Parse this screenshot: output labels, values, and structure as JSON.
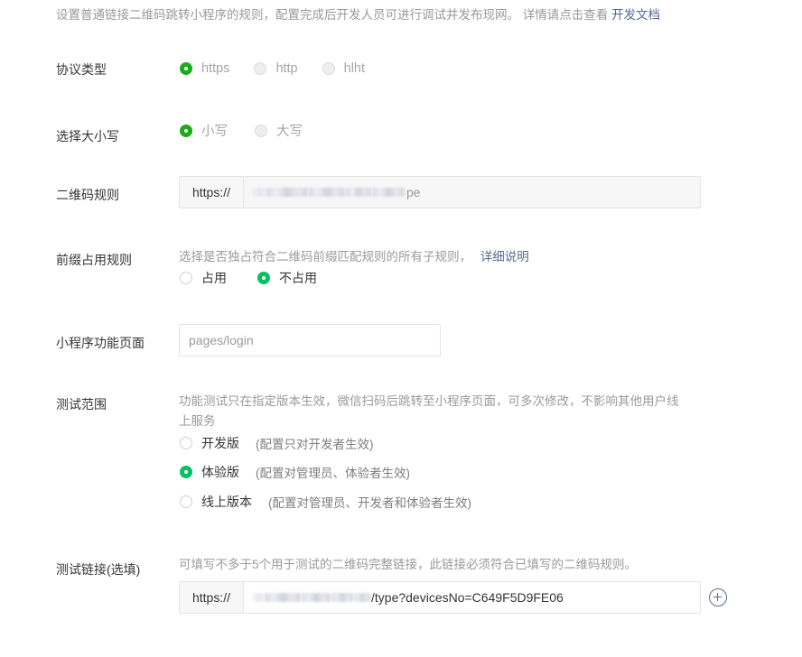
{
  "intro": {
    "text": "设置普通链接二维码跳转小程序的规则，配置完成后开发人员可进行调试并发布现网。 详情请点击查看",
    "link": "开发文档"
  },
  "protocol": {
    "label": "协议类型",
    "options": [
      "https",
      "http",
      "hlht"
    ],
    "selected": "https"
  },
  "case": {
    "label": "选择大小写",
    "options": [
      "小写",
      "大写"
    ],
    "selected": "小写"
  },
  "qr_rule": {
    "label": "二维码规则",
    "prefix": "https://",
    "value_suffix": "pe"
  },
  "prefix_rule": {
    "label": "前缀占用规则",
    "hint": "选择是否独占符合二维码前缀匹配规则的所有子规则，",
    "link": "详细说明",
    "options": [
      "占用",
      "不占用"
    ],
    "selected": "不占用"
  },
  "page": {
    "label": "小程序功能页面",
    "value": "pages/login"
  },
  "scope": {
    "label": "测试范围",
    "hint_line1": "功能测试只在指定版本生效，微信扫码后跳转至小程序页面，可多次修改，不影响其他用户线",
    "hint_line2": "上服务",
    "options": [
      {
        "label": "开发版",
        "note": "(配置只对开发者生效)"
      },
      {
        "label": "体验版",
        "note": "(配置对管理员、体验者生效)"
      },
      {
        "label": "线上版本",
        "note": "(配置对管理员、开发者和体验者生效)"
      }
    ],
    "selected": "体验版"
  },
  "test_link": {
    "label": "测试链接(选填)",
    "hint": "可填写不多于5个用于测试的二维码完整链接，此链接必须符合已填写的二维码规则。",
    "prefix": "https://",
    "value_suffix": "/type?devicesNo=C649F5D9FE06"
  },
  "colors": {
    "accent_green": "#07c160",
    "disabled_green": "#1aad19",
    "link_blue": "#576b95"
  }
}
